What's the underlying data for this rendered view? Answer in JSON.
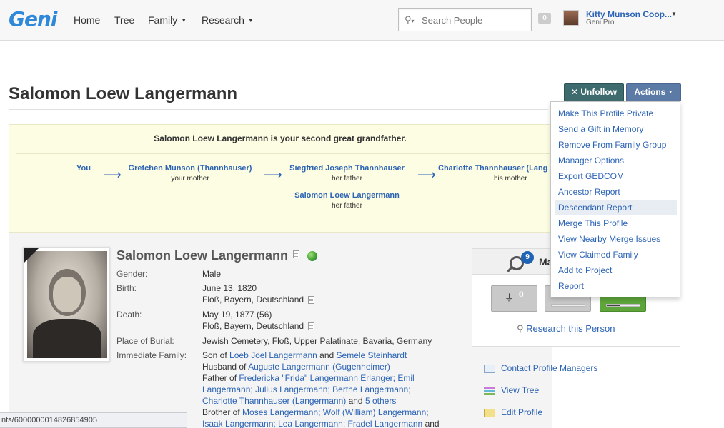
{
  "brand": {
    "logo_text": "Geni",
    "accent": "#2f88d8"
  },
  "nav": {
    "home": "Home",
    "tree": "Tree",
    "family": "Family",
    "research": "Research"
  },
  "search": {
    "placeholder": "Search People",
    "icon": "search-icon"
  },
  "notifications": {
    "count": "0"
  },
  "user": {
    "name": "Kitty Munson Coop...",
    "plan": "Geni Pro"
  },
  "page": {
    "title": "Salomon Loew Langermann"
  },
  "buttons": {
    "unfollow": "✕ Unfollow",
    "actions": "Actions"
  },
  "relationship": {
    "heading": "Salomon Loew Langermann is your second great grandfather.",
    "path": [
      {
        "name": "You",
        "relation": ""
      },
      {
        "name": "Gretchen Munson (Thannhauser)",
        "relation": "your mother"
      },
      {
        "name": "Siegfried Joseph Thannhauser",
        "relation": "her father"
      },
      {
        "name": "Charlotte Thannhauser (Lang",
        "relation": "his mother"
      },
      {
        "name": "Salomon Loew Langermann",
        "relation": "her father"
      }
    ]
  },
  "profile": {
    "name": "Salomon Loew Langermann",
    "fields": {
      "gender_label": "Gender:",
      "gender": "Male",
      "birth_label": "Birth:",
      "birth_date": "June 13, 1820",
      "birth_place": "Floß, Bayern, Deutschland",
      "death_label": "Death:",
      "death_date": "May 19, 1877 (56)",
      "death_place": "Floß, Bayern, Deutschland",
      "burial_label": "Place of Burial:",
      "burial": "Jewish Cemetery, Floß, Upper Palatinate, Bavaria, Germany",
      "family_label": "Immediate Family:"
    },
    "family": {
      "son_of_prefix": "Son of",
      "parent1": "Loeb Joel Langermann",
      "and1": "and",
      "parent2": "Semele Steinhardt",
      "husband_prefix": "Husband of",
      "spouse": "Auguste Langermann (Gugenheimer)",
      "father_prefix": "Father of",
      "child1": "Fredericka \"Frida\" Langermann Erlanger;",
      "child2a": "Emil",
      "child2b": "Langermann;",
      "child3": "Julius Langermann;",
      "child4": "Berthe Langermann;",
      "child5": "Charlotte Thannhauser (Langermann)",
      "and2": "and",
      "others": "5 others",
      "brother_prefix": "Brother of",
      "sib1": "Moses Langermann;",
      "sib2": "Wolf (William) Langermann;",
      "sib3": "Isaak Langermann;",
      "sib4": "Lea Langermann;",
      "sib5": "Fradel Langermann",
      "and3": "and"
    }
  },
  "research": {
    "title": "Ma",
    "badge": "9",
    "match_count": "0",
    "link": "Research this Person",
    "progress_fraction": 0.4
  },
  "side_links": {
    "contact": "Contact Profile Managers",
    "view_tree": "View Tree",
    "edit": "Edit Profile"
  },
  "actions_menu": [
    "Make This Profile Private",
    "Send a Gift in Memory",
    "Remove From Family Group",
    "Manager Options",
    "Export GEDCOM",
    "Ancestor Report",
    "Descendant Report",
    "Merge This Profile",
    "View Nearby Merge Issues",
    "View Claimed Family",
    "Add to Project",
    "Report"
  ],
  "status_bar": {
    "url": "nts/6000000014826854905"
  }
}
